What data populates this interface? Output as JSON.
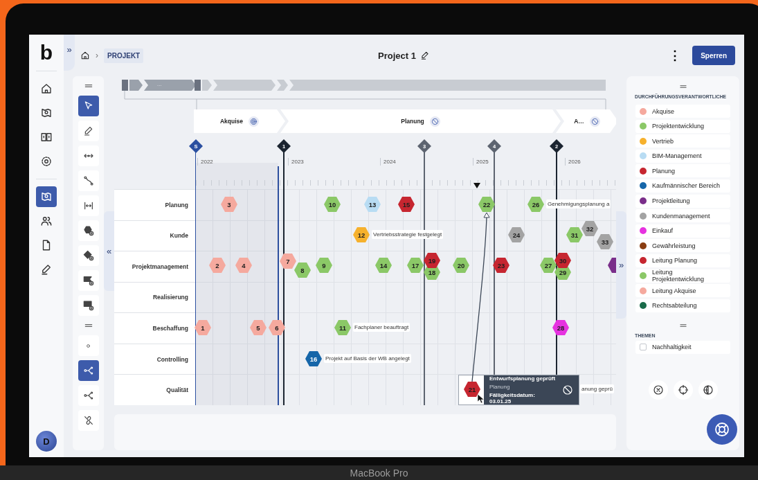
{
  "header": {
    "expand_toggle": "»",
    "breadcrumb_separator": "›",
    "breadcrumb": "PROJEKT",
    "title": "Project 1",
    "more_menu": "⋮",
    "lock_button": "Sperren"
  },
  "nav": {
    "logo": "b",
    "items": [
      {
        "selected": false
      },
      {
        "selected": false
      },
      {
        "selected": false
      },
      {
        "selected": false
      },
      {
        "selected": true
      },
      {
        "selected": false
      },
      {
        "selected": false
      },
      {
        "selected": false
      }
    ],
    "avatar": "D"
  },
  "tools": [
    {
      "selected": true
    },
    {
      "selected": false
    },
    {
      "selected": false
    },
    {
      "selected": false
    },
    {
      "selected": false
    },
    {
      "selected": false
    },
    {
      "selected": false
    },
    {
      "selected": false
    },
    {
      "selected": false
    },
    {
      "selected": false
    },
    {
      "selected": true
    },
    {
      "selected": false
    },
    {
      "selected": false
    }
  ],
  "collapse_left": "«",
  "collapse_right": "»",
  "timeline": {
    "overview_label": "...",
    "phases": [
      {
        "label": "Akquise",
        "kind": "active"
      },
      {
        "label": "Planung",
        "kind": "blocked"
      },
      {
        "label": "A…",
        "kind": "blocked"
      }
    ],
    "milestones": [
      {
        "label": "S",
        "kind": "start"
      },
      {
        "label": "1",
        "kind": "done"
      },
      {
        "label": "3",
        "kind": "open"
      },
      {
        "label": "4",
        "kind": "open"
      },
      {
        "label": "2",
        "kind": "done"
      }
    ],
    "years": [
      "2022",
      "2023",
      "2024",
      "2025",
      "2026"
    ],
    "rows": [
      {
        "label": "Planung",
        "nodes": [
          {
            "number": "3",
            "color": "#f5a99e"
          },
          {
            "number": "10",
            "color": "#8bc867"
          },
          {
            "number": "13",
            "color": "#b8dcf3"
          },
          {
            "number": "15",
            "color": "#c62630"
          },
          {
            "number": "22",
            "color": "#8bc867"
          },
          {
            "number": "26",
            "color": "#8bc867",
            "label": "Genehmigungsplanung a"
          }
        ]
      },
      {
        "label": "Kunde",
        "nodes": [
          {
            "number": "12",
            "color": "#f6b12d",
            "label": "Vertriebsstrategie festgelegt"
          },
          {
            "number": "24",
            "color": "#a3a3a3"
          },
          {
            "number": "31",
            "color": "#8bc867"
          },
          {
            "number": "32",
            "color": "#a3a3a3"
          },
          {
            "number": "33",
            "color": "#a3a3a3"
          }
        ]
      },
      {
        "label": "Projektmanagement",
        "nodes": [
          {
            "number": "2",
            "color": "#f5a99e"
          },
          {
            "number": "4",
            "color": "#f5a99e"
          },
          {
            "number": "7",
            "color": "#f5a99e"
          },
          {
            "number": "8",
            "color": "#8bc867"
          },
          {
            "number": "9",
            "color": "#8bc867"
          },
          {
            "number": "14",
            "color": "#8bc867"
          },
          {
            "number": "17",
            "color": "#8bc867"
          },
          {
            "number": "18",
            "color": "#8bc867"
          },
          {
            "number": "19",
            "color": "#c62630"
          },
          {
            "number": "20",
            "color": "#8bc867"
          },
          {
            "number": "23",
            "color": "#c62630"
          },
          {
            "number": "27",
            "color": "#8bc867"
          },
          {
            "number": "29",
            "color": "#8bc867"
          },
          {
            "number": "30",
            "color": "#c62630"
          },
          {
            "color": "#7a2e8a"
          }
        ]
      },
      {
        "label": "Realisierung",
        "nodes": []
      },
      {
        "label": "Beschaffung",
        "nodes": [
          {
            "number": "1",
            "color": "#f5a99e"
          },
          {
            "number": "5",
            "color": "#f5a99e"
          },
          {
            "number": "6",
            "color": "#f5a99e"
          },
          {
            "number": "11",
            "color": "#8bc867",
            "label": "Fachplaner beauftragt"
          },
          {
            "number": "28",
            "color": "#e632e0"
          }
        ]
      },
      {
        "label": "Controlling",
        "nodes": [
          {
            "number": "16",
            "color": "#1666a9",
            "label": "Projekt auf Basis der WB angelegt"
          }
        ]
      },
      {
        "label": "Qualität",
        "nodes": [
          {
            "number": "21",
            "color": "#c62630",
            "label": "anung geprü"
          }
        ]
      }
    ],
    "hover_card": {
      "title": "Entwurfsplanung geprüft",
      "subtitle": "Planung",
      "due": "Fälligkeitsdatum: 03.01.25"
    }
  },
  "legend": {
    "title": "DURCHFÜHRUNGSVERANTWORTLICHE",
    "items": [
      {
        "label": "Akquise",
        "color": "#f5a99e"
      },
      {
        "label": "Projektentwicklung",
        "color": "#8bc867"
      },
      {
        "label": "Vertrieb",
        "color": "#f6b12d"
      },
      {
        "label": "BIM-Management",
        "color": "#b8dcf3"
      },
      {
        "label": "Planung",
        "color": "#c62630"
      },
      {
        "label": "Kaufmännischer Bereich",
        "color": "#1666a9"
      },
      {
        "label": "Projektleitung",
        "color": "#7a2e8a"
      },
      {
        "label": "Kundenmanagement",
        "color": "#a3a3a3"
      },
      {
        "label": "Einkauf",
        "color": "#e632e0"
      },
      {
        "label": "Gewährleistung",
        "color": "#8a3d12"
      },
      {
        "label": "Leitung Planung",
        "color": "#c62630"
      },
      {
        "label": "Leitung Projektentwicklung",
        "color": "#8bc867"
      },
      {
        "label": "Leitung Akquise",
        "color": "#f5a99e"
      },
      {
        "label": "Rechtsabteilung",
        "color": "#1a6b4a"
      }
    ]
  },
  "themes": {
    "title": "THEMEN",
    "items": [
      {
        "label": "Nachhaltigkeit",
        "checked": false
      }
    ]
  },
  "device_label": "MacBook Pro"
}
